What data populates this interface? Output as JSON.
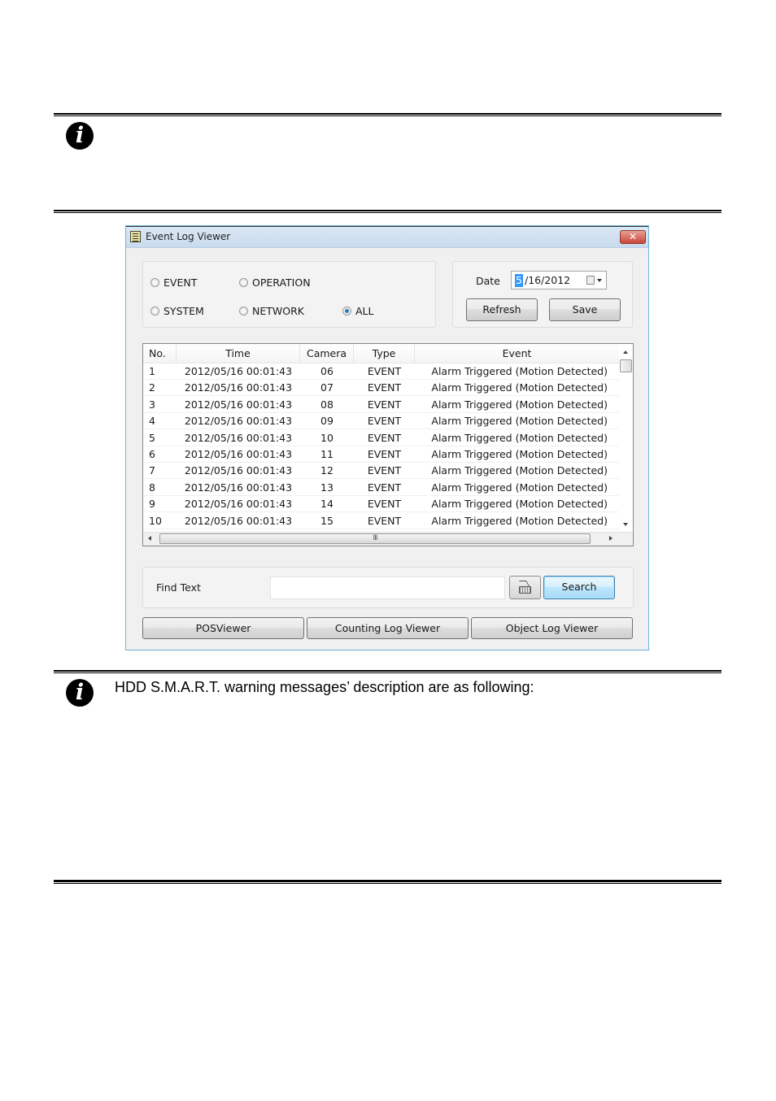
{
  "note1": {
    "icon": "info-icon",
    "text": ""
  },
  "note2": {
    "icon": "info-icon",
    "text": "HDD S.M.A.R.T. warning messages’ description are as following:"
  },
  "window": {
    "title": "Event Log Viewer",
    "close_label": "✕",
    "filters": [
      {
        "label": "EVENT",
        "selected": false
      },
      {
        "label": "OPERATION",
        "selected": false
      },
      {
        "label": "SYSTEM",
        "selected": false
      },
      {
        "label": "NETWORK",
        "selected": false
      },
      {
        "label": "ALL",
        "selected": true
      }
    ],
    "date": {
      "label": "Date",
      "selected_part": "5",
      "rest": "/16/2012"
    },
    "refresh_label": "Refresh",
    "save_label": "Save",
    "table": {
      "columns": [
        "No.",
        "Time",
        "Camera",
        "Type",
        "Event"
      ],
      "rows": [
        [
          "1",
          "2012/05/16 00:01:43",
          "06",
          "EVENT",
          "Alarm Triggered (Motion Detected)"
        ],
        [
          "2",
          "2012/05/16 00:01:43",
          "07",
          "EVENT",
          "Alarm Triggered (Motion Detected)"
        ],
        [
          "3",
          "2012/05/16 00:01:43",
          "08",
          "EVENT",
          "Alarm Triggered (Motion Detected)"
        ],
        [
          "4",
          "2012/05/16 00:01:43",
          "09",
          "EVENT",
          "Alarm Triggered (Motion Detected)"
        ],
        [
          "5",
          "2012/05/16 00:01:43",
          "10",
          "EVENT",
          "Alarm Triggered (Motion Detected)"
        ],
        [
          "6",
          "2012/05/16 00:01:43",
          "11",
          "EVENT",
          "Alarm Triggered (Motion Detected)"
        ],
        [
          "7",
          "2012/05/16 00:01:43",
          "12",
          "EVENT",
          "Alarm Triggered (Motion Detected)"
        ],
        [
          "8",
          "2012/05/16 00:01:43",
          "13",
          "EVENT",
          "Alarm Triggered (Motion Detected)"
        ],
        [
          "9",
          "2012/05/16 00:01:43",
          "14",
          "EVENT",
          "Alarm Triggered (Motion Detected)"
        ],
        [
          "10",
          "2012/05/16 00:01:43",
          "15",
          "EVENT",
          "Alarm Triggered (Motion Detected)"
        ]
      ],
      "hscroll_grip": "III"
    },
    "find": {
      "label": "Find Text",
      "value": "",
      "placeholder": ""
    },
    "search_label": "Search",
    "bottom_buttons": [
      "POSViewer",
      "Counting Log Viewer",
      "Object Log Viewer"
    ]
  }
}
